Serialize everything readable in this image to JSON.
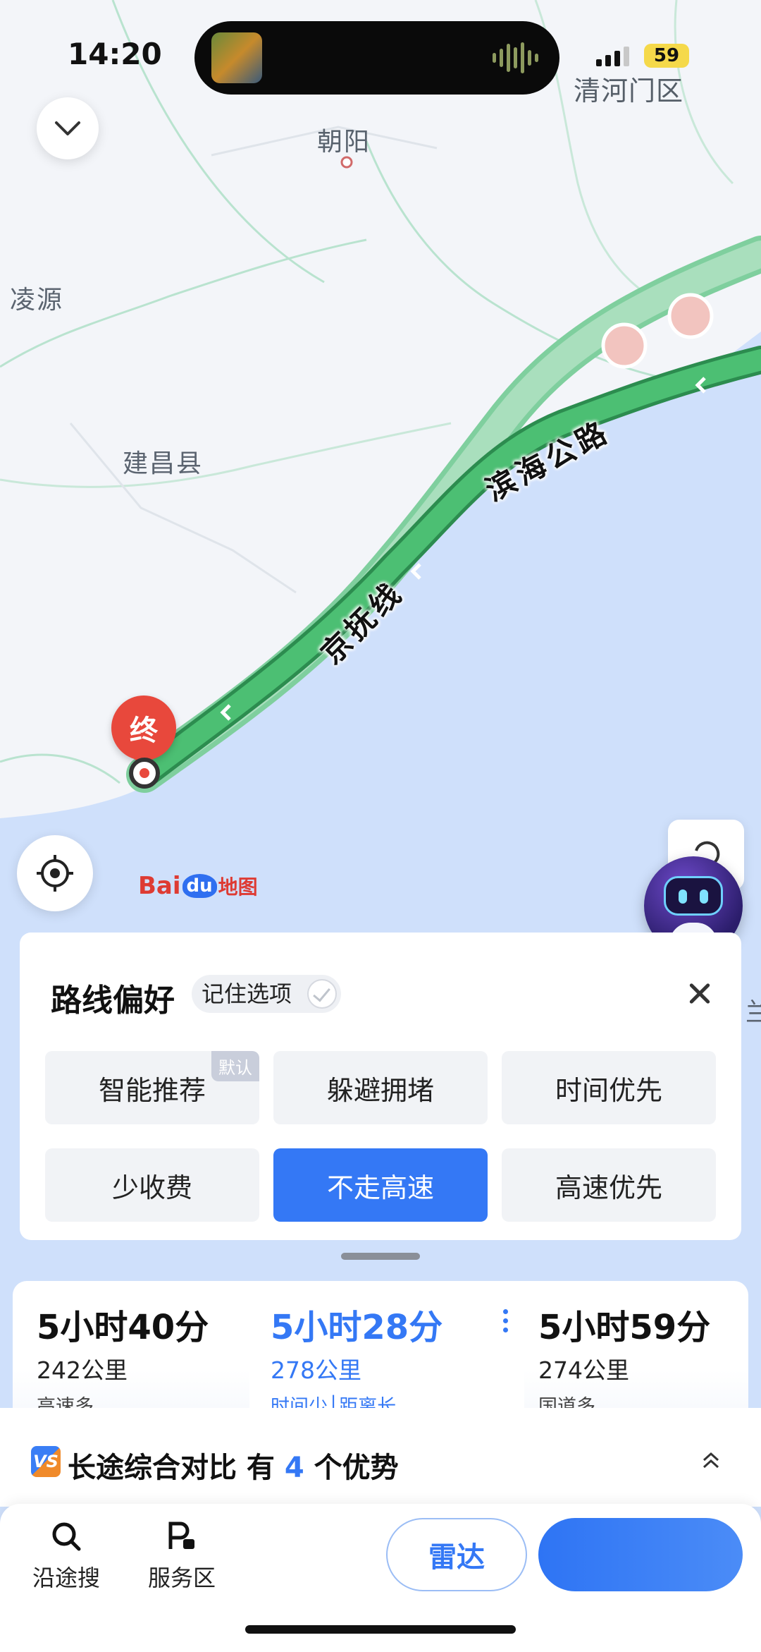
{
  "status_bar": {
    "time": "14:20",
    "battery": "59",
    "district": "清河门区"
  },
  "map": {
    "places": {
      "chaoyang": "朝阳",
      "lingyuan": "凌源",
      "jianchang": "建昌县",
      "edge": "兰"
    },
    "roads": {
      "binhai": "滨海公路",
      "jingfu": "京抚线"
    },
    "end_marker": "终",
    "logo": {
      "bai": "Bai",
      "du": "du",
      "cn": "地图"
    },
    "colors": {
      "route_main": "#4cbf73",
      "route_alt": "#8fd3a8",
      "sea": "#cfe0fb",
      "land": "#f3f5f9"
    }
  },
  "preference_panel": {
    "title": "路线偏好",
    "remember_label": "记住选项",
    "default_badge": "默认",
    "options": [
      {
        "label": "智能推荐",
        "active": false
      },
      {
        "label": "躲避拥堵",
        "active": false
      },
      {
        "label": "时间优先",
        "active": false
      },
      {
        "label": "少收费",
        "active": false
      },
      {
        "label": "不走高速",
        "active": true
      },
      {
        "label": "高速优先",
        "active": false
      }
    ]
  },
  "routes": [
    {
      "duration": "5小时40分",
      "distance": "242公里",
      "tag": "高速多"
    },
    {
      "duration": "5小时28分",
      "distance": "278公里",
      "tag": "时间少│距离长"
    },
    {
      "duration": "5小时59分",
      "distance": "274公里",
      "tag": "国道多"
    }
  ],
  "compare": {
    "vs": "VS",
    "prefix": "长途综合对比 有 ",
    "count": "4",
    "suffix": " 个优势"
  },
  "bottom_bar": {
    "search_along": "沿途搜",
    "service_area": "服务区",
    "radar": "雷达"
  }
}
